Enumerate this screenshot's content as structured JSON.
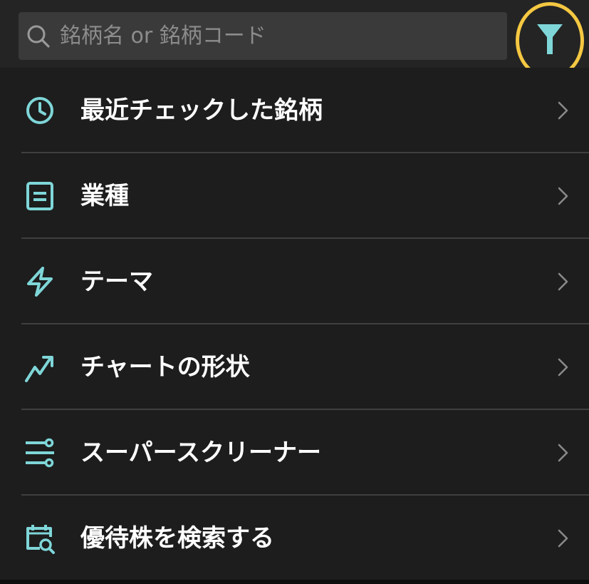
{
  "search": {
    "placeholder": "銘柄名 or 銘柄コード",
    "value": ""
  },
  "filter": {
    "icon": "filter-funnel-icon",
    "highlight_color": "#f5c842"
  },
  "colors": {
    "accent": "#7fd6d8",
    "chevron": "#8a8a8a"
  },
  "menu": {
    "items": [
      {
        "label": "最近チェックした銘柄",
        "icon": "clock-icon"
      },
      {
        "label": "業種",
        "icon": "list-document-icon"
      },
      {
        "label": "テーマ",
        "icon": "lightning-icon"
      },
      {
        "label": "チャートの形状",
        "icon": "trending-up-icon"
      },
      {
        "label": "スーパースクリーナー",
        "icon": "sliders-icon"
      },
      {
        "label": "優待株を検索する",
        "icon": "calendar-search-icon"
      }
    ]
  }
}
